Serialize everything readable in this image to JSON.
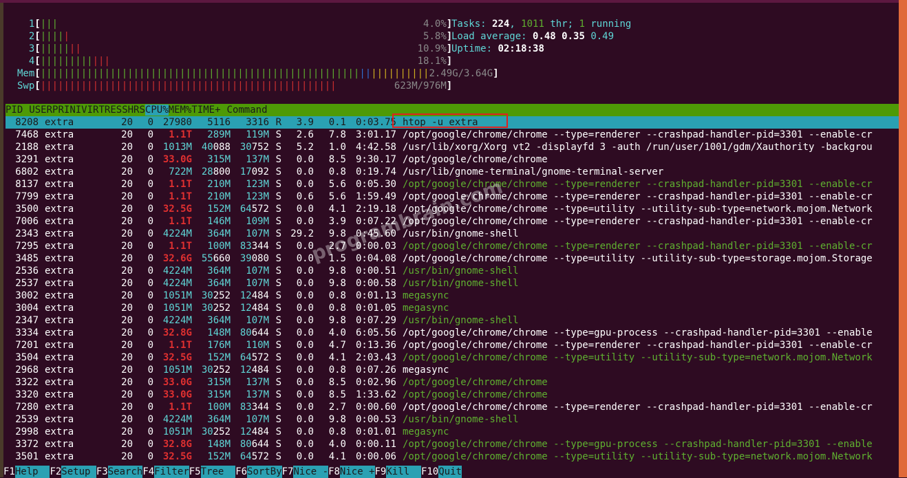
{
  "cpus": [
    {
      "id": "1",
      "bars": [
        {
          "c": "g",
          "n": 3
        }
      ],
      "pct": "4.0%"
    },
    {
      "id": "2",
      "bars": [
        {
          "c": "g",
          "n": 4
        },
        {
          "c": "r",
          "n": 1
        }
      ],
      "pct": "5.8%"
    },
    {
      "id": "3",
      "bars": [
        {
          "c": "g",
          "n": 5
        },
        {
          "c": "r",
          "n": 2
        }
      ],
      "pct": "10.9%"
    },
    {
      "id": "4",
      "bars": [
        {
          "c": "g",
          "n": 9
        },
        {
          "c": "r",
          "n": 3
        }
      ],
      "pct": "18.1%"
    }
  ],
  "mem": {
    "label": "Mem",
    "bars": [
      {
        "c": "g",
        "n": 55
      },
      {
        "c": "b",
        "n": 2
      },
      {
        "c": "y",
        "n": 10
      }
    ],
    "value": "2.49G/3.64G"
  },
  "swp": {
    "label": "Swp",
    "bars": [
      {
        "c": "r",
        "n": 51
      }
    ],
    "value": "623M/976M"
  },
  "summary": {
    "tasks_label": "Tasks:",
    "tasks": "224",
    "thr": "1011",
    "thr_label": "thr;",
    "running": "1",
    "running_label": "running",
    "load_label": "Load average:",
    "load1": "0.48",
    "load5": "0.35",
    "load15": "0.49",
    "uptime_label": "Uptime:",
    "uptime": "02:18:38"
  },
  "header": [
    "PID",
    "USER",
    "PRI",
    "NI",
    "VIRT",
    "RES",
    "SHR",
    "S",
    "CPU%",
    "MEM%",
    "TIME+",
    "Command"
  ],
  "rows": [
    [
      "8208",
      "extra",
      "20",
      "0",
      "27980",
      "5116",
      "3316",
      "R",
      "3.9",
      "0.1",
      "0:03.75",
      "htop -u extra",
      "sel"
    ],
    [
      "7468",
      "extra",
      "20",
      "0",
      "1.1T",
      "289M",
      "119M",
      "S",
      "2.6",
      "7.8",
      "3:01.17",
      "/opt/google/chrome/chrome --type=renderer --crashpad-handler-pid=3301 --enable-cr",
      ""
    ],
    [
      "2188",
      "extra",
      "20",
      "0",
      "1013M",
      "40088",
      "30752",
      "S",
      "5.2",
      "1.0",
      "4:42.58",
      "/usr/lib/xorg/Xorg vt2 -displayfd 3 -auth /run/user/1001/gdm/Xauthority -backgrou",
      ""
    ],
    [
      "3291",
      "extra",
      "20",
      "0",
      "33.0G",
      "315M",
      "137M",
      "S",
      "0.0",
      "8.5",
      "9:30.17",
      "/opt/google/chrome/chrome",
      ""
    ],
    [
      "6802",
      "extra",
      "20",
      "0",
      "722M",
      "28800",
      "17092",
      "S",
      "0.0",
      "0.8",
      "0:19.74",
      "/usr/lib/gnome-terminal/gnome-terminal-server",
      ""
    ],
    [
      "8137",
      "extra",
      "20",
      "0",
      "1.1T",
      "210M",
      "123M",
      "S",
      "0.0",
      "5.6",
      "0:05.30",
      "/opt/google/chrome/chrome --type=renderer --crashpad-handler-pid=3301 --enable-cr",
      "thread"
    ],
    [
      "7799",
      "extra",
      "20",
      "0",
      "1.1T",
      "210M",
      "123M",
      "S",
      "0.6",
      "5.6",
      "1:59.49",
      "/opt/google/chrome/chrome --type=renderer --crashpad-handler-pid=3301 --enable-cr",
      ""
    ],
    [
      "3500",
      "extra",
      "20",
      "0",
      "32.5G",
      "152M",
      "64572",
      "S",
      "0.0",
      "4.1",
      "2:19.18",
      "/opt/google/chrome/chrome --type=utility --utility-sub-type=network.mojom.Network",
      ""
    ],
    [
      "7006",
      "extra",
      "20",
      "0",
      "1.1T",
      "146M",
      "109M",
      "S",
      "0.0",
      "3.9",
      "0:07.22",
      "/opt/google/chrome/chrome --type=renderer --crashpad-handler-pid=3301 --enable-cr",
      ""
    ],
    [
      "2343",
      "extra",
      "20",
      "0",
      "4224M",
      "364M",
      "107M",
      "S",
      "29.2",
      "9.8",
      "0:45.60",
      "/usr/bin/gnome-shell",
      ""
    ],
    [
      "7295",
      "extra",
      "20",
      "0",
      "1.1T",
      "100M",
      "83344",
      "S",
      "0.0",
      "2.7",
      "0:00.03",
      "/opt/google/chrome/chrome --type=renderer --crashpad-handler-pid=3301 --enable-cr",
      "thread"
    ],
    [
      "3485",
      "extra",
      "20",
      "0",
      "32.6G",
      "55660",
      "39080",
      "S",
      "0.0",
      "1.5",
      "0:04.08",
      "/opt/google/chrome/chrome --type=utility --utility-sub-type=storage.mojom.Storage",
      ""
    ],
    [
      "2536",
      "extra",
      "20",
      "0",
      "4224M",
      "364M",
      "107M",
      "S",
      "0.0",
      "9.8",
      "0:00.51",
      "/usr/bin/gnome-shell",
      "thread"
    ],
    [
      "2537",
      "extra",
      "20",
      "0",
      "4224M",
      "364M",
      "107M",
      "S",
      "0.0",
      "9.8",
      "0:00.58",
      "/usr/bin/gnome-shell",
      "thread"
    ],
    [
      "3002",
      "extra",
      "20",
      "0",
      "1051M",
      "30252",
      "12484",
      "S",
      "0.0",
      "0.8",
      "0:01.13",
      "megasync",
      "thread"
    ],
    [
      "3004",
      "extra",
      "20",
      "0",
      "1051M",
      "30252",
      "12484",
      "S",
      "0.0",
      "0.8",
      "0:01.05",
      "megasync",
      "thread"
    ],
    [
      "2347",
      "extra",
      "20",
      "0",
      "4224M",
      "364M",
      "107M",
      "S",
      "0.0",
      "9.8",
      "0:07.29",
      "/usr/bin/gnome-shell",
      "thread"
    ],
    [
      "3334",
      "extra",
      "20",
      "0",
      "32.8G",
      "148M",
      "80644",
      "S",
      "0.0",
      "4.0",
      "6:05.56",
      "/opt/google/chrome/chrome --type=gpu-process --crashpad-handler-pid=3301 --enable",
      ""
    ],
    [
      "7201",
      "extra",
      "20",
      "0",
      "1.1T",
      "176M",
      "110M",
      "S",
      "0.0",
      "4.7",
      "0:13.36",
      "/opt/google/chrome/chrome --type=renderer --crashpad-handler-pid=3301 --enable-cr",
      ""
    ],
    [
      "3504",
      "extra",
      "20",
      "0",
      "32.5G",
      "152M",
      "64572",
      "S",
      "0.0",
      "4.1",
      "2:03.43",
      "/opt/google/chrome/chrome --type=utility --utility-sub-type=network.mojom.Network",
      "thread"
    ],
    [
      "2968",
      "extra",
      "20",
      "0",
      "1051M",
      "30252",
      "12484",
      "S",
      "0.0",
      "0.8",
      "0:07.26",
      "megasync",
      ""
    ],
    [
      "3322",
      "extra",
      "20",
      "0",
      "33.0G",
      "315M",
      "137M",
      "S",
      "0.0",
      "8.5",
      "0:02.96",
      "/opt/google/chrome/chrome",
      "thread"
    ],
    [
      "3320",
      "extra",
      "20",
      "0",
      "33.0G",
      "315M",
      "137M",
      "S",
      "0.0",
      "8.5",
      "1:33.62",
      "/opt/google/chrome/chrome",
      "thread"
    ],
    [
      "7280",
      "extra",
      "20",
      "0",
      "1.1T",
      "100M",
      "83344",
      "S",
      "0.0",
      "2.7",
      "0:00.60",
      "/opt/google/chrome/chrome --type=renderer --crashpad-handler-pid=3301 --enable-cr",
      ""
    ],
    [
      "2539",
      "extra",
      "20",
      "0",
      "4224M",
      "364M",
      "107M",
      "S",
      "0.0",
      "9.8",
      "0:00.53",
      "/usr/bin/gnome-shell",
      "thread"
    ],
    [
      "2998",
      "extra",
      "20",
      "0",
      "1051M",
      "30252",
      "12484",
      "S",
      "0.0",
      "0.8",
      "0:01.01",
      "megasync",
      "thread"
    ],
    [
      "3372",
      "extra",
      "20",
      "0",
      "32.8G",
      "148M",
      "80644",
      "S",
      "0.0",
      "4.0",
      "0:00.11",
      "/opt/google/chrome/chrome --type=gpu-process --crashpad-handler-pid=3301 --enable",
      "thread"
    ],
    [
      "3501",
      "extra",
      "20",
      "0",
      "32.5G",
      "152M",
      "64572",
      "S",
      "0.0",
      "4.1",
      "0:00.06",
      "/opt/google/chrome/chrome --type=utility --utility-sub-type=network.mojom.Network",
      "thread"
    ]
  ],
  "footer": [
    {
      "key": "F1",
      "label": "Help  "
    },
    {
      "key": "F2",
      "label": "Setup "
    },
    {
      "key": "F3",
      "label": "Search"
    },
    {
      "key": "F4",
      "label": "Filter"
    },
    {
      "key": "F5",
      "label": "Tree  "
    },
    {
      "key": "F6",
      "label": "SortBy"
    },
    {
      "key": "F7",
      "label": "Nice -"
    },
    {
      "key": "F8",
      "label": "Nice +"
    },
    {
      "key": "F9",
      "label": "Kill  "
    },
    {
      "key": "F10",
      "label": "Quit"
    }
  ],
  "watermark": "programbrain.com"
}
